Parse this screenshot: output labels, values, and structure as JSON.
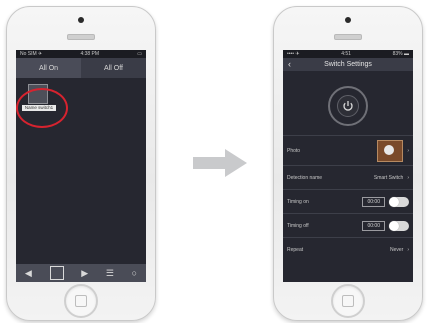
{
  "left_screen": {
    "status_left": "No SIM ✈",
    "status_center": "4:38 PM",
    "tabs": [
      "All On",
      "All Off"
    ],
    "tile_label": "Name switch1"
  },
  "right_screen": {
    "status_left": "•••• ✈",
    "status_center": "4:51",
    "status_right": "83% ▬",
    "title": "Switch Settings",
    "rows": {
      "photo": {
        "label": "Photo"
      },
      "device_name": {
        "label": "Detection name",
        "value": "Smart Switch"
      },
      "timing_on": {
        "label": "Timing on",
        "value": "00:00"
      },
      "timing_off": {
        "label": "Timing off",
        "value": "00:00"
      },
      "repeat": {
        "label": "Repeat",
        "value": "Never"
      }
    }
  },
  "colors": {
    "screen_bg": "#262730",
    "highlight": "#d7232f",
    "arrow": "#c9cacc"
  }
}
